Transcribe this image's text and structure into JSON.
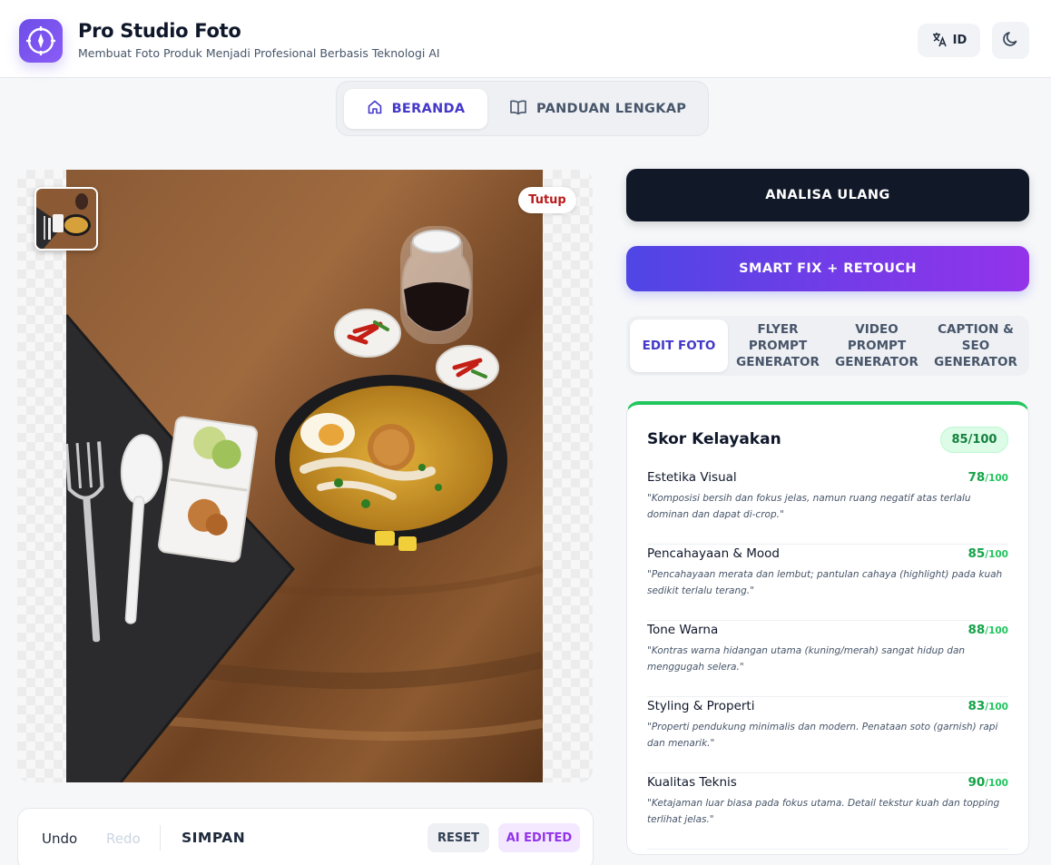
{
  "header": {
    "title": "Pro Studio Foto",
    "subtitle": "Membuat Foto Produk Menjadi Profesional Berbasis Teknologi AI",
    "lang_label": "ID",
    "logo_icon": "compass-icon",
    "theme_icon": "moon-icon",
    "lang_icon": "translate-icon"
  },
  "nav": {
    "tabs": [
      {
        "label": "BERANDA",
        "icon": "home-icon",
        "active": true
      },
      {
        "label": "PANDUAN LENGKAP",
        "icon": "book-icon",
        "active": false
      }
    ]
  },
  "image_panel": {
    "close_label": "Tutup"
  },
  "toolbar": {
    "undo_label": "Undo",
    "redo_label": "Redo",
    "save_label": "SIMPAN",
    "reset_label": "RESET",
    "ai_label": "AI EDITED"
  },
  "actions": {
    "analisa_label": "ANALISA ULANG",
    "smartfix_label": "SMART FIX + RETOUCH"
  },
  "subtabs": [
    {
      "label": "EDIT FOTO",
      "active": true
    },
    {
      "label": "FLYER PROMPT GENERATOR",
      "active": false
    },
    {
      "label": "VIDEO PROMPT GENERATOR",
      "active": false
    },
    {
      "label": "CAPTION & SEO GENERATOR",
      "active": false
    }
  ],
  "score": {
    "title": "Skor Kelayakan",
    "total": "85/100",
    "suffix": "/100",
    "criteria": [
      {
        "name": "Estetika Visual",
        "score": "78",
        "desc": "\"Komposisi bersih dan fokus jelas, namun ruang negatif atas terlalu dominan dan dapat di-crop.\""
      },
      {
        "name": "Pencahayaan & Mood",
        "score": "85",
        "desc": "\"Pencahayaan merata dan lembut; pantulan cahaya (highlight) pada kuah sedikit terlalu terang.\""
      },
      {
        "name": "Tone Warna",
        "score": "88",
        "desc": "\"Kontras warna hidangan utama (kuning/merah) sangat hidup dan menggugah selera.\""
      },
      {
        "name": "Styling & Properti",
        "score": "83",
        "desc": "\"Properti pendukung minimalis dan modern. Penataan soto (garnish) rapi dan menarik.\""
      },
      {
        "name": "Kualitas Teknis",
        "score": "90",
        "desc": "\"Ketajaman luar biasa pada fokus utama. Detail tekstur kuah dan topping terlihat jelas.\""
      }
    ]
  },
  "colors": {
    "accent": "#4338ca",
    "primary_dark": "#111827",
    "gradient_start": "#4f46e5",
    "gradient_end": "#9333ea",
    "score_green": "#16a34a"
  }
}
